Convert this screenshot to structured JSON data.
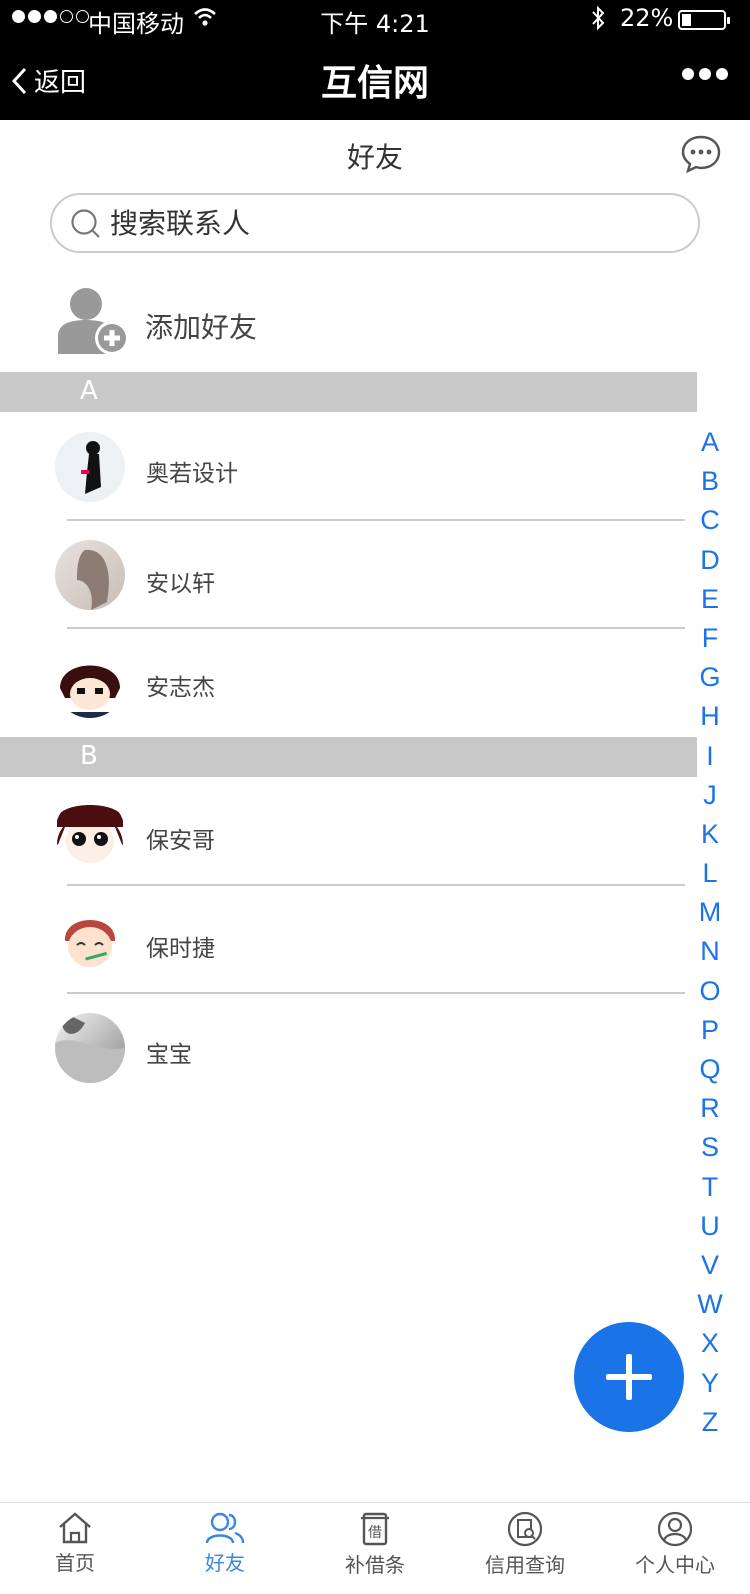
{
  "status_bar": {
    "carrier": "中国移动",
    "time": "下午 4:21",
    "battery_percent": "22%",
    "battery_level": 0.22
  },
  "nav": {
    "back_label": "返回",
    "title": "互信网"
  },
  "page": {
    "subtitle": "好友"
  },
  "search": {
    "placeholder": "搜索联系人"
  },
  "add_friend": {
    "label": "添加好友"
  },
  "sections": [
    {
      "letter": "A",
      "contacts": [
        "奥若设计",
        "安以轩",
        "安志杰"
      ]
    },
    {
      "letter": "B",
      "contacts": [
        "保安哥",
        "保时捷",
        "宝宝"
      ]
    }
  ],
  "index_letters": [
    "A",
    "B",
    "C",
    "D",
    "E",
    "F",
    "G",
    "H",
    "I",
    "J",
    "K",
    "L",
    "M",
    "N",
    "O",
    "P",
    "Q",
    "R",
    "S",
    "T",
    "U",
    "V",
    "W",
    "X",
    "Y",
    "Z"
  ],
  "tabbar": {
    "items": [
      {
        "label": "首页",
        "icon": "home-icon"
      },
      {
        "label": "好友",
        "icon": "friends-icon",
        "active": true
      },
      {
        "label": "补借条",
        "icon": "iou-icon"
      },
      {
        "label": "信用查询",
        "icon": "credit-search-icon"
      },
      {
        "label": "个人中心",
        "icon": "profile-icon"
      }
    ]
  },
  "colors": {
    "accent": "#1a74e8",
    "nav_background": "#000000",
    "section_header": "#c8c8c8"
  }
}
